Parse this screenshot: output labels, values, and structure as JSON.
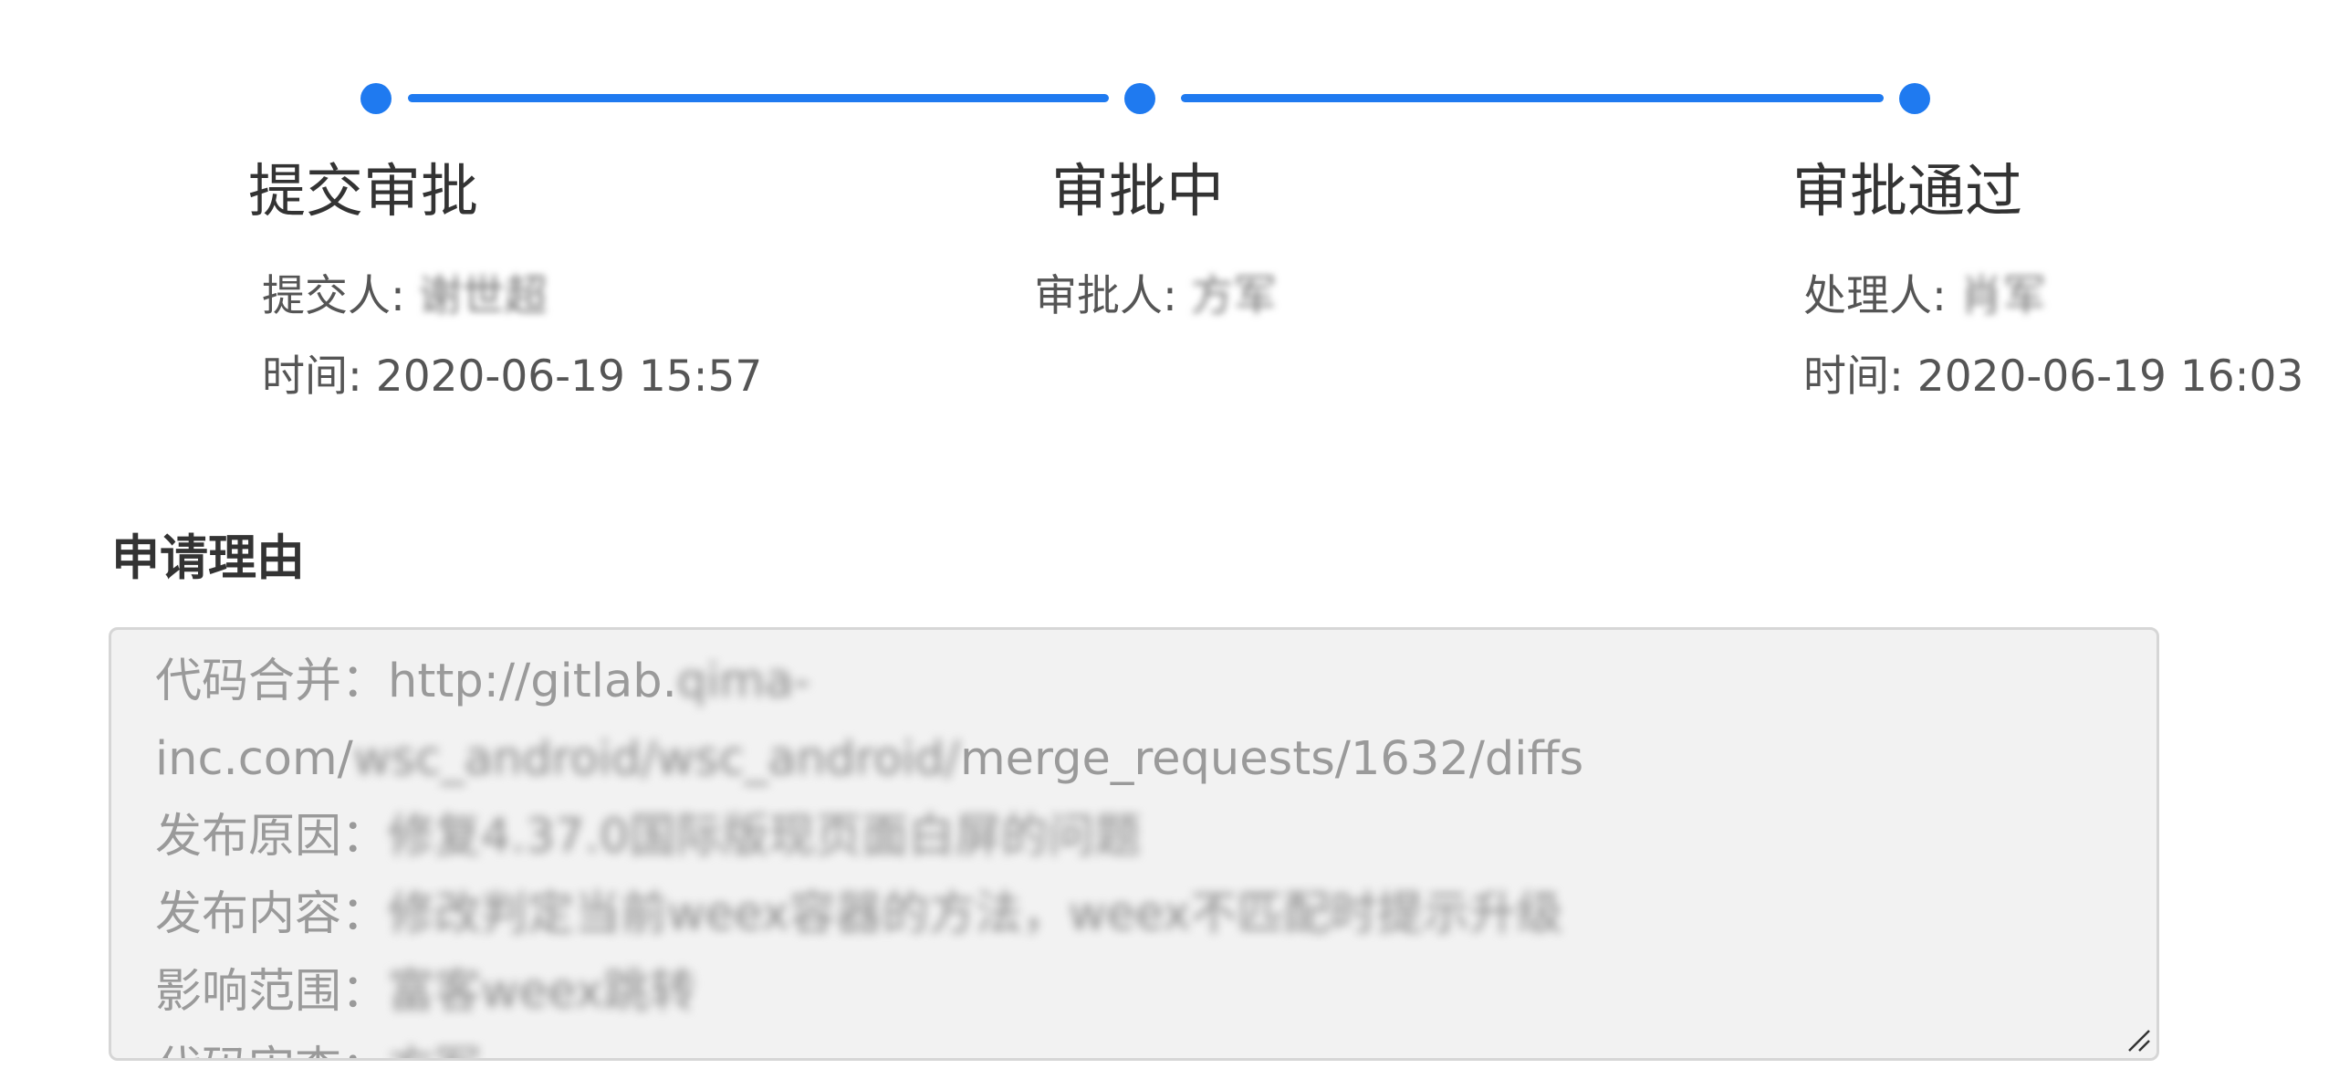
{
  "steps": [
    {
      "title": "提交审批",
      "person_label": "提交人:",
      "person_value": "谢世超",
      "time_label": "时间:",
      "time_value": "2020-06-19 15:57"
    },
    {
      "title": "审批中",
      "person_label": "审批人:",
      "person_value": "方军"
    },
    {
      "title": "审批通过",
      "person_label": "处理人:",
      "person_value": "肖军",
      "time_label": "时间:",
      "time_value": "2020-06-19 16:03"
    }
  ],
  "reason": {
    "label": "申请理由",
    "lines": [
      {
        "prefix": "代码合并：http://gitlab.",
        "masked": "qima-",
        "suffix": ""
      },
      {
        "prefix": "inc.com/",
        "masked": "wsc_android/wsc_android/",
        "suffix": "merge_requests/1632/diffs"
      },
      {
        "prefix": "发布原因：",
        "masked": "修复4.37.0国际版现页面白屏的问题",
        "suffix": ""
      },
      {
        "prefix": "发布内容：",
        "masked": "修改判定当前weex容器的方法，weex不匹配时提示升级",
        "suffix": ""
      },
      {
        "prefix": "影响范围：",
        "masked": "富客weex跳转",
        "suffix": ""
      },
      {
        "prefix": "代码审查：",
        "masked": "方军——",
        "suffix": ""
      }
    ]
  },
  "colors": {
    "accent": "#1f7af0",
    "box_bg": "#f2f2f2",
    "box_border": "#d6d6d6"
  }
}
